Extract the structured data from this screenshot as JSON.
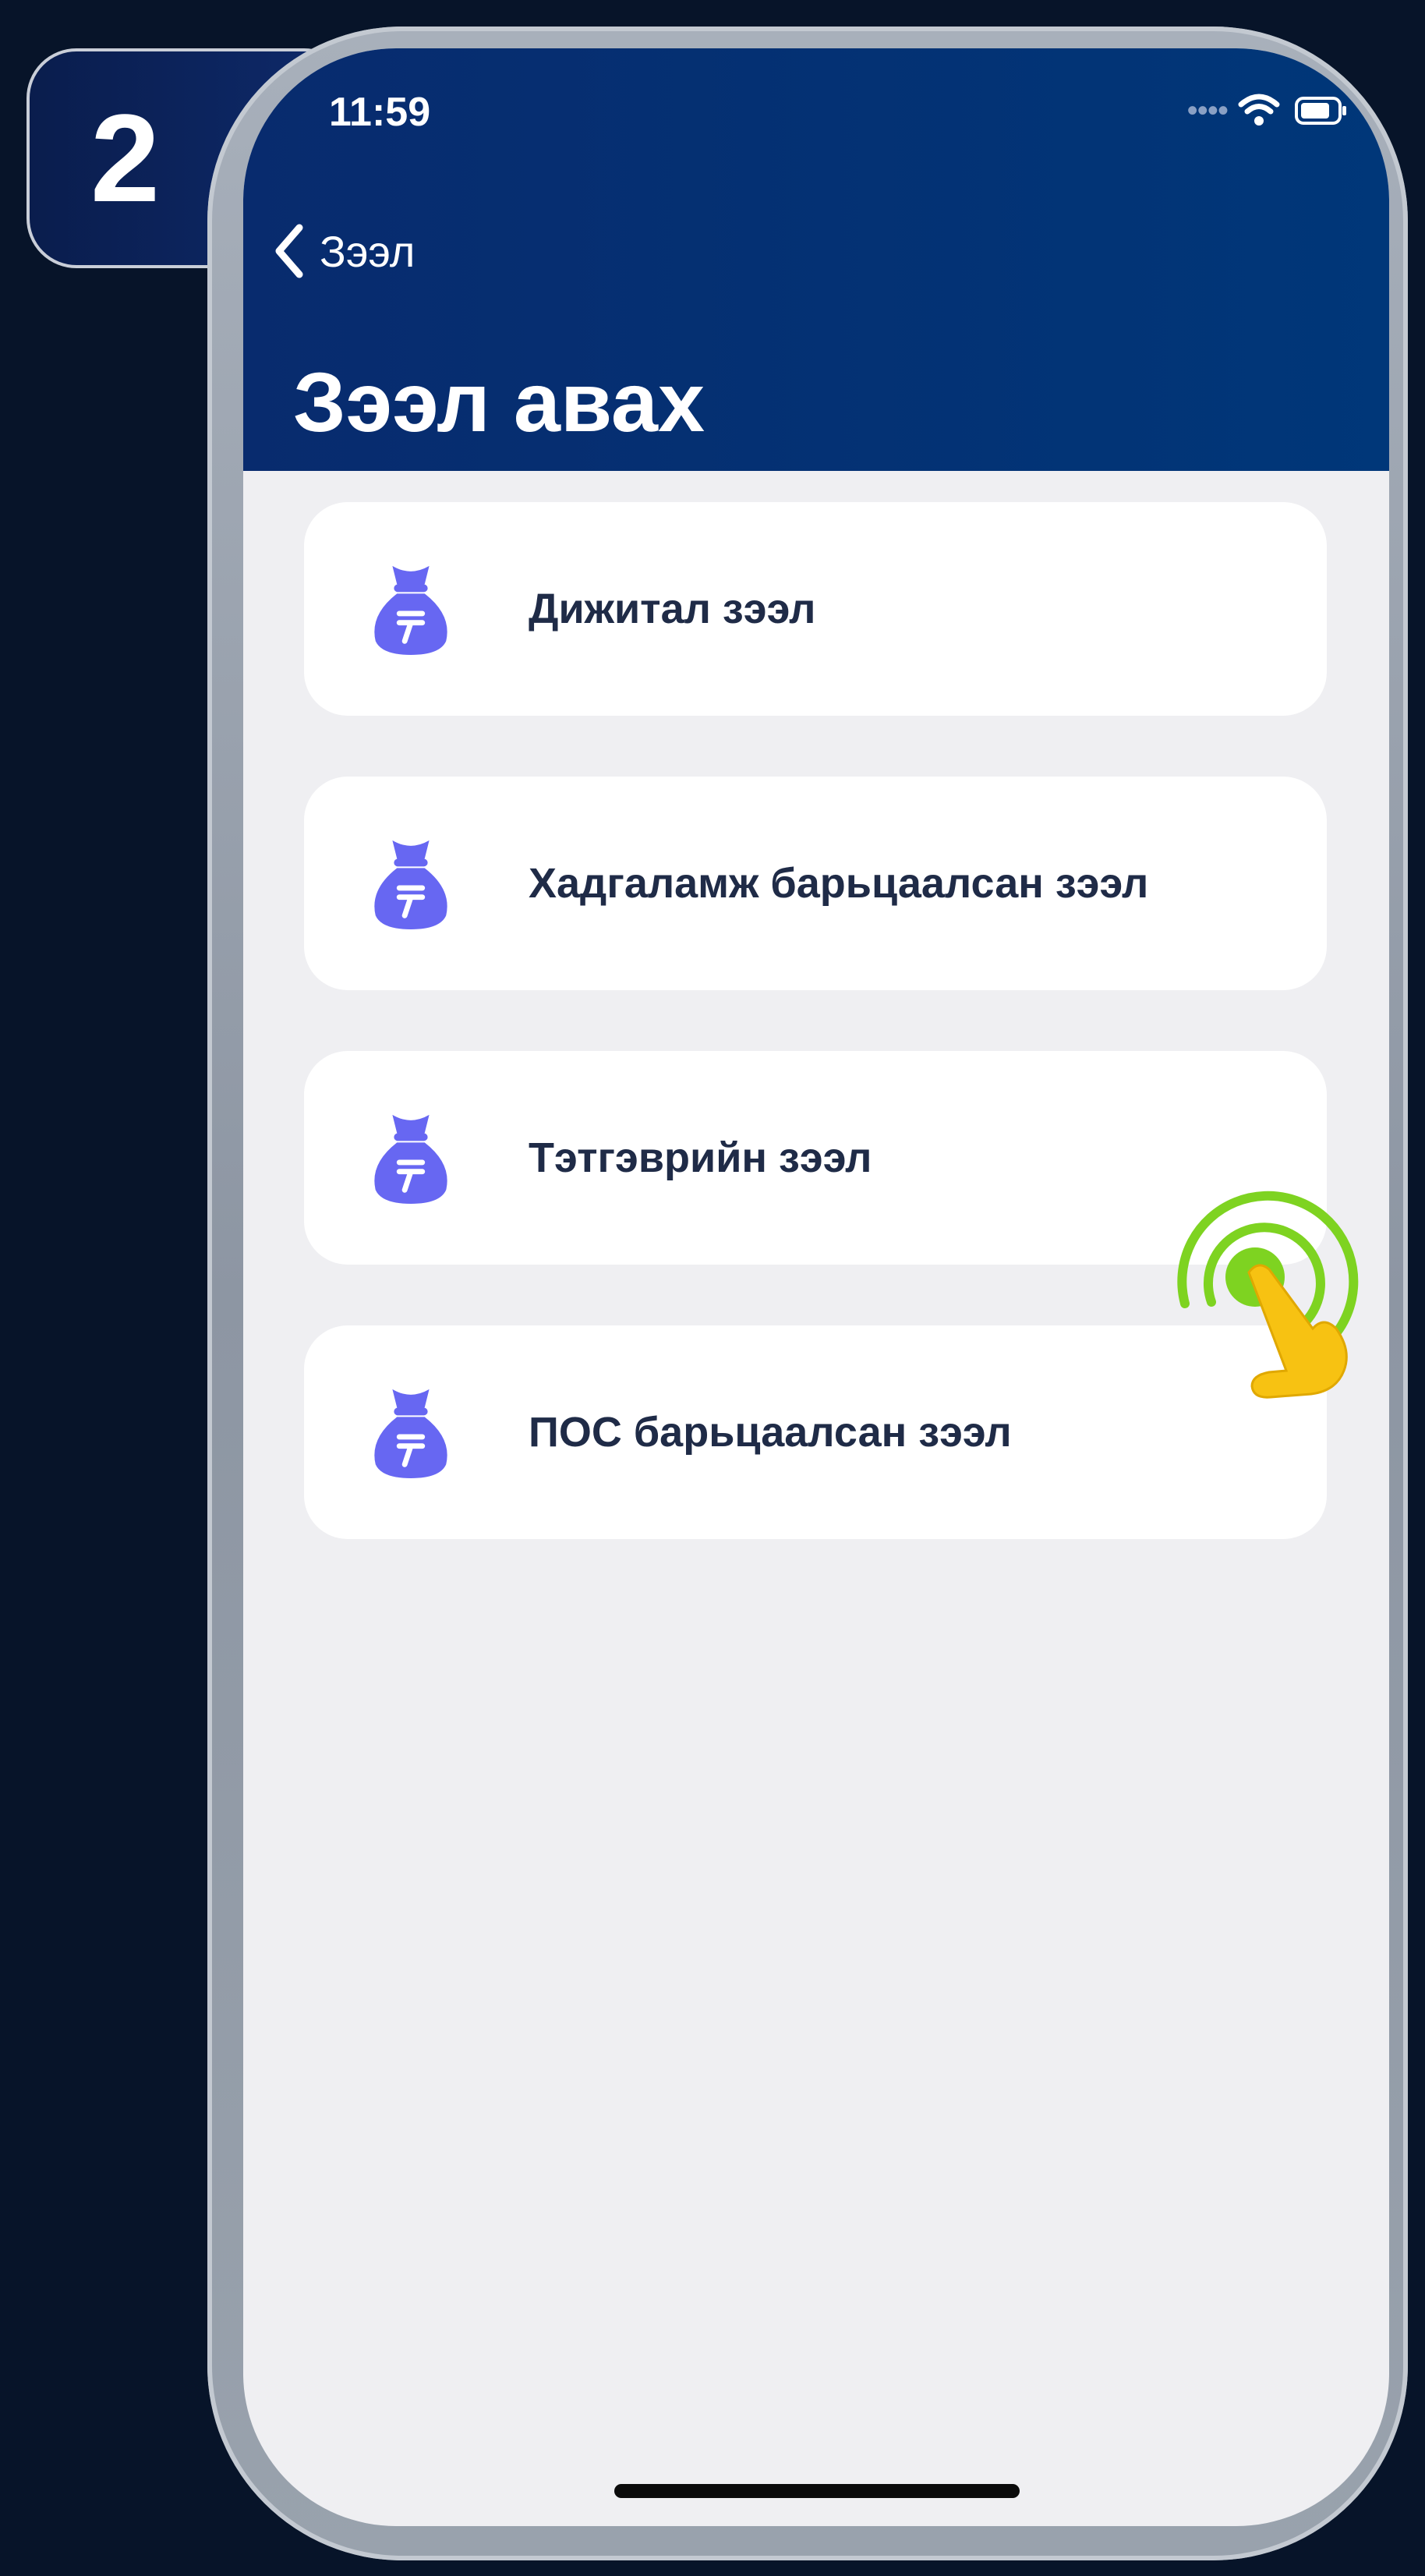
{
  "step_badge": {
    "number": "2"
  },
  "status_bar": {
    "time": "11:59",
    "icons": [
      "cellular-dots-icon",
      "wifi-icon",
      "battery-icon"
    ]
  },
  "nav": {
    "back_label": "Зээл",
    "back_icon": "chevron-left-icon"
  },
  "page": {
    "title": "Зээл авах"
  },
  "loan_options": [
    {
      "label": "Дижитал зээл",
      "icon": "money-bag-icon"
    },
    {
      "label": "Хадгаламж барьцаалсан зээл",
      "icon": "money-bag-icon"
    },
    {
      "label": "Тэтгэврийн зээл",
      "icon": "money-bag-icon"
    },
    {
      "label": "ПОС барьцаалсан зээл",
      "icon": "money-bag-icon"
    }
  ],
  "tap_hint": {
    "target": "Тэтгэврийн зээл",
    "icon": "tap-hand-icon"
  },
  "colors": {
    "background": "#071429",
    "header": "#003779",
    "screen_bg": "#efeff2",
    "card_bg": "#ffffff",
    "icon_accent": "#6767f2",
    "label_text": "#1f2b47",
    "tap_ring": "#7ed321",
    "hand": "#f7c212"
  }
}
